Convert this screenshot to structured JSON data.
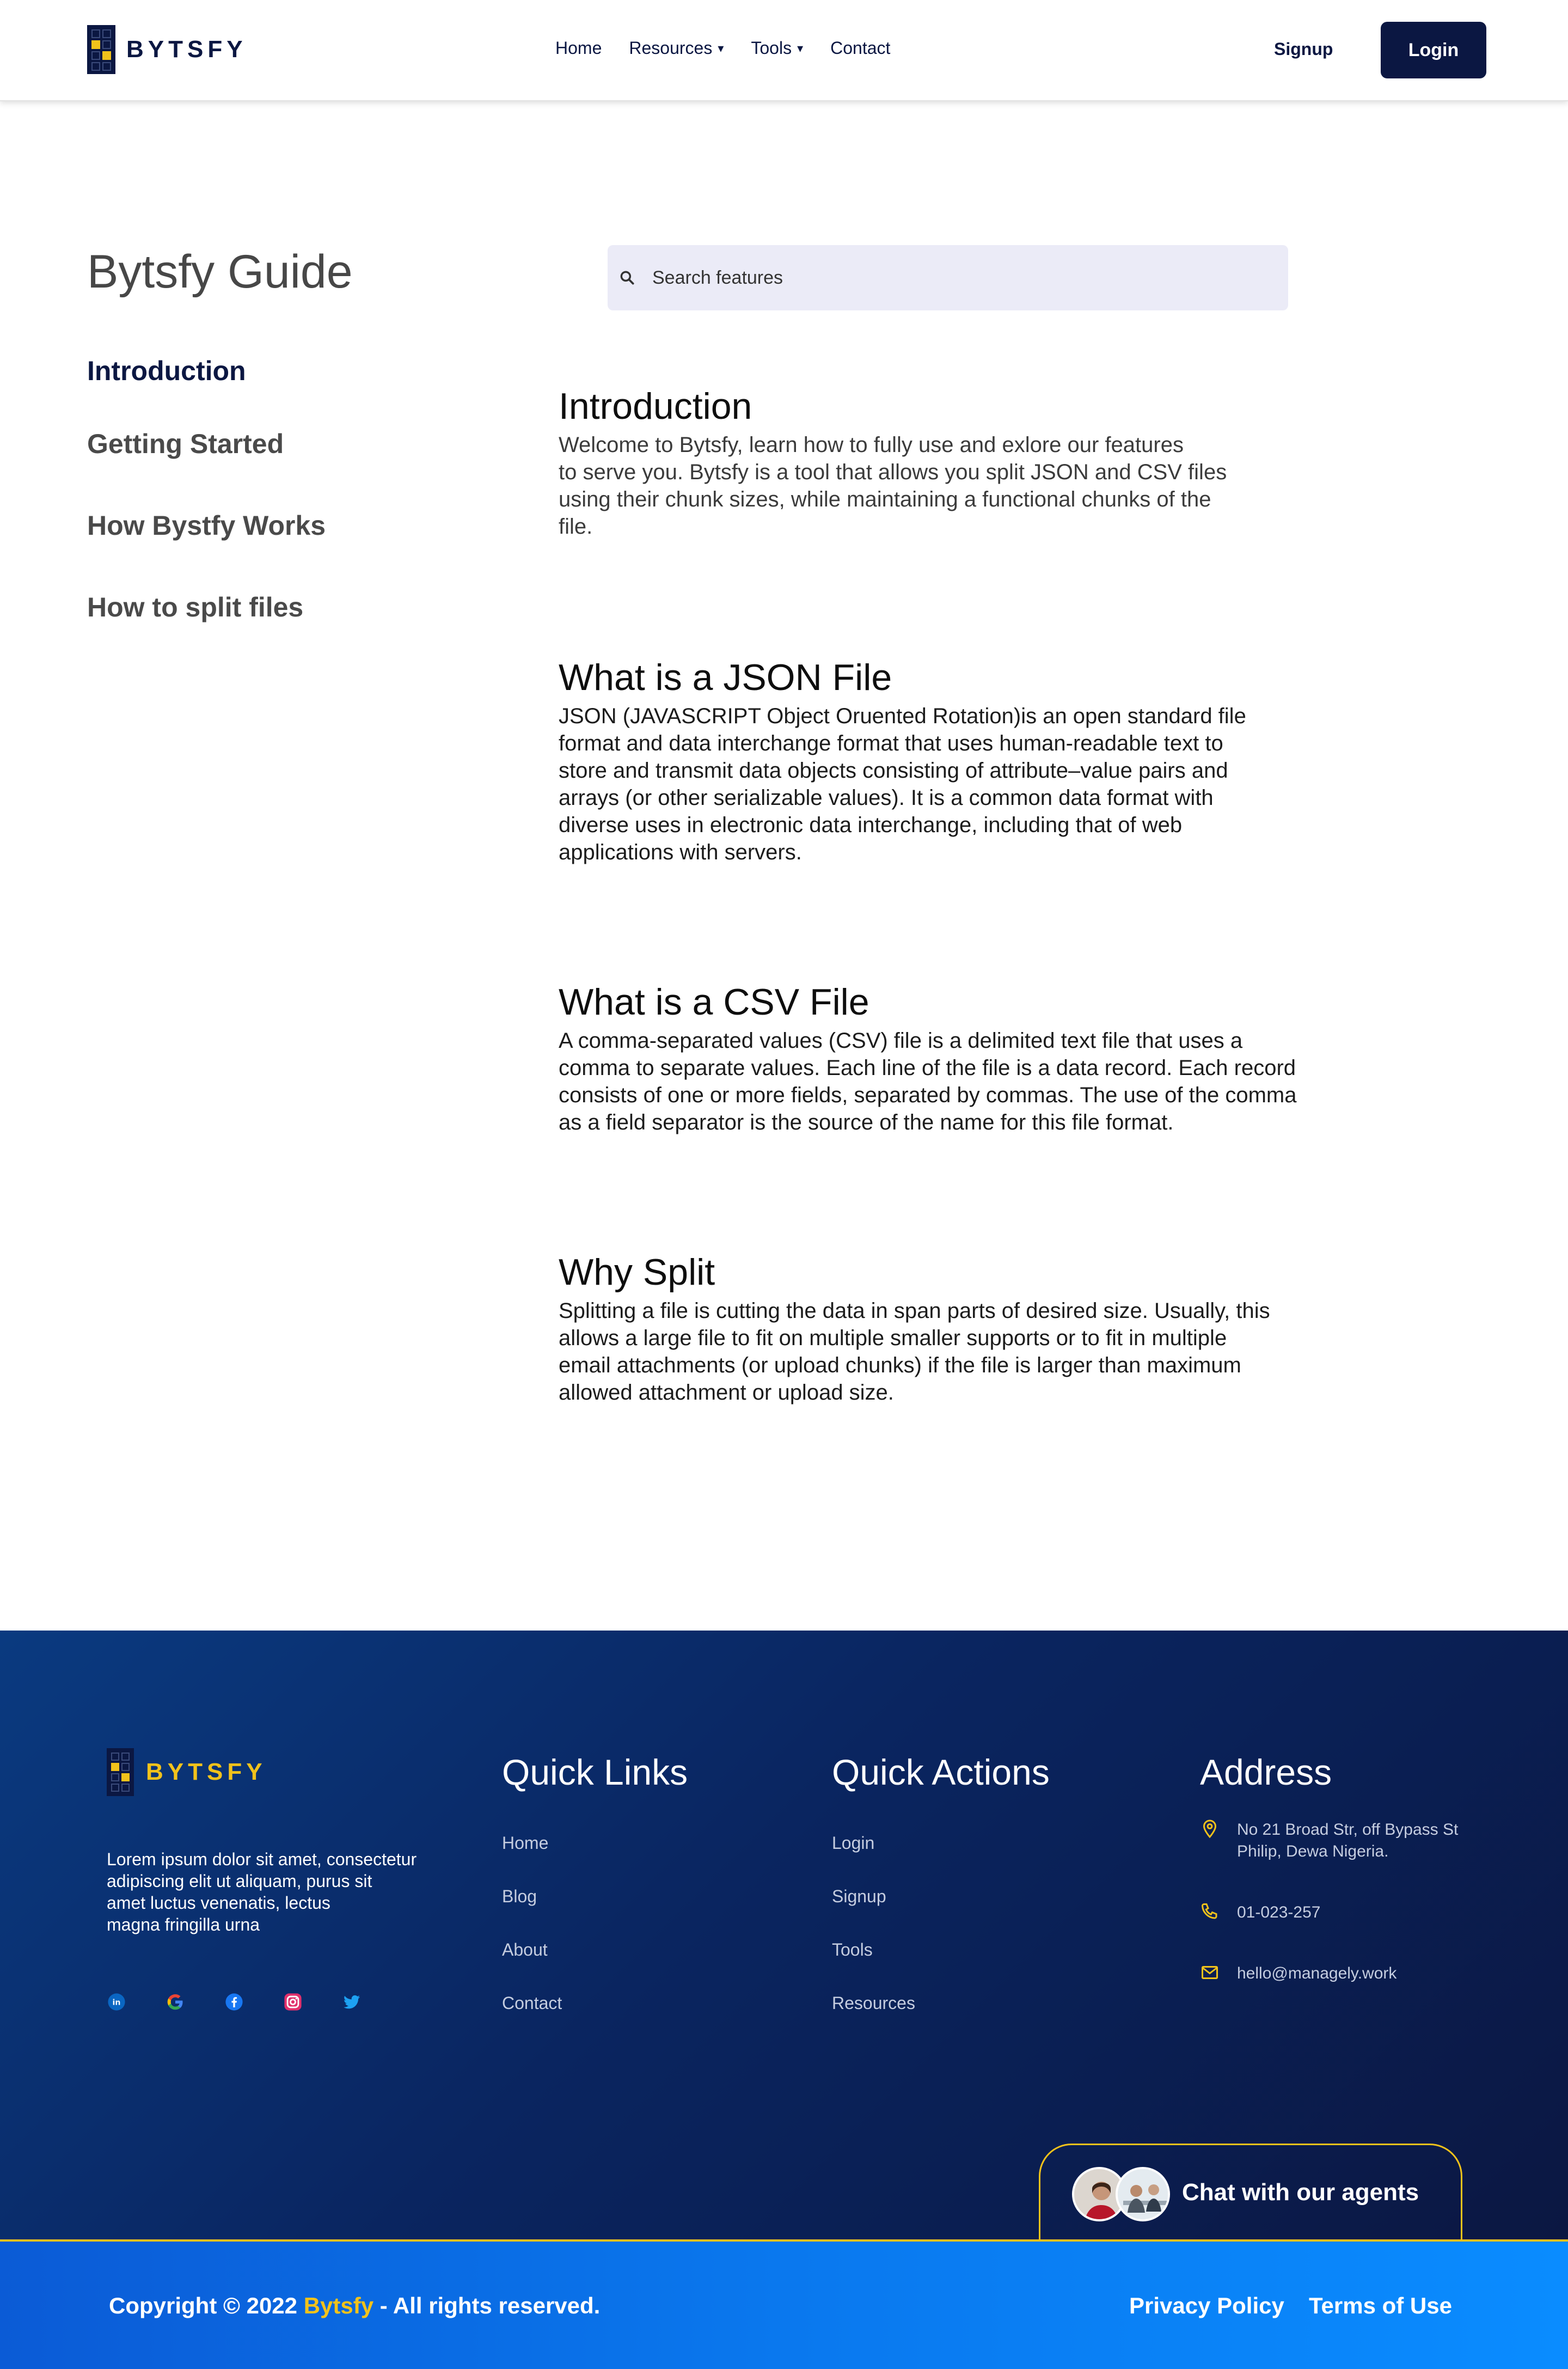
{
  "brand": {
    "name": "BYTSFY",
    "primary": "#0b1742",
    "accent": "#f2c21b"
  },
  "nav": {
    "links": [
      {
        "label": "Home"
      },
      {
        "label": "Resources",
        "dropdown": true
      },
      {
        "label": "Tools",
        "dropdown": true
      },
      {
        "label": "Contact"
      }
    ],
    "signup": "Signup",
    "login": "Login"
  },
  "sidebar": {
    "title": "Bytsfy Guide",
    "items": [
      {
        "label": "Introduction",
        "active": true
      },
      {
        "label": "Getting Started"
      },
      {
        "label": "How Bystfy Works"
      },
      {
        "label": "How to split files"
      }
    ]
  },
  "search": {
    "placeholder": "Search features",
    "value": ""
  },
  "sections": [
    {
      "title": "Introduction",
      "lines": [
        "Welcome to Bytsfy, learn how to fully use and exlore our features",
        "to serve you. Bytsfy is a tool that allows you split JSON and CSV files",
        "using their chunk sizes, while maintaining a functional chunks of the",
        "file."
      ]
    },
    {
      "title": "What is a JSON File",
      "lines": [
        "JSON (JAVASCRIPT Object Oruented Rotation)is an open standard file",
        "format and data interchange format that uses human-readable text to",
        "store and transmit data objects consisting of attribute–value pairs and",
        "arrays (or other serializable values). It is a common data format with",
        "diverse uses in electronic data interchange, including that of web",
        "applications with servers."
      ]
    },
    {
      "title": "What is a CSV File",
      "lines": [
        "A comma-separated values (CSV) file is a delimited text file that uses a",
        "comma to separate values. Each line of the file is a data record. Each record",
        "consists of one or more fields, separated by commas. The use of the comma",
        "as a field separator is the source of the name for this file format."
      ]
    },
    {
      "title": "Why Split",
      "lines": [
        "Splitting a file is cutting the data in span parts of desired size. Usually, this",
        "allows a large file to fit on multiple smaller supports or to fit in multiple",
        "email attachments (or upload chunks) if the file is larger than maximum",
        "allowed attachment or upload size."
      ]
    }
  ],
  "footer": {
    "brand": "BYTSFY",
    "description": [
      "Lorem ipsum dolor sit amet, consectetur",
      "adipiscing elit ut aliquam, purus sit",
      "amet luctus venenatis, lectus",
      "magna fringilla urna"
    ],
    "socials": [
      "linkedin-icon",
      "google-icon",
      "facebook-icon",
      "instagram-icon",
      "twitter-icon"
    ],
    "quick_links": {
      "title": "Quick Links",
      "items": [
        "Home",
        "Blog",
        "About",
        "Contact"
      ]
    },
    "quick_actions": {
      "title": "Quick Actions",
      "items": [
        "Login",
        "Signup",
        "Tools",
        "Resources"
      ]
    },
    "address": {
      "title": "Address",
      "street": [
        "No 21 Broad Str, off Bypass St",
        "Philip, Dewa Nigeria."
      ],
      "phone": "01-023-257",
      "email": "hello@managely.work"
    },
    "chat": "Chat with our agents",
    "copyright_prefix": "Copyright © 2022 ",
    "copyright_brand": "Bytsfy",
    "copyright_suffix": " - All rights reserved.",
    "privacy": "Privacy Policy",
    "terms": "Terms of Use"
  }
}
